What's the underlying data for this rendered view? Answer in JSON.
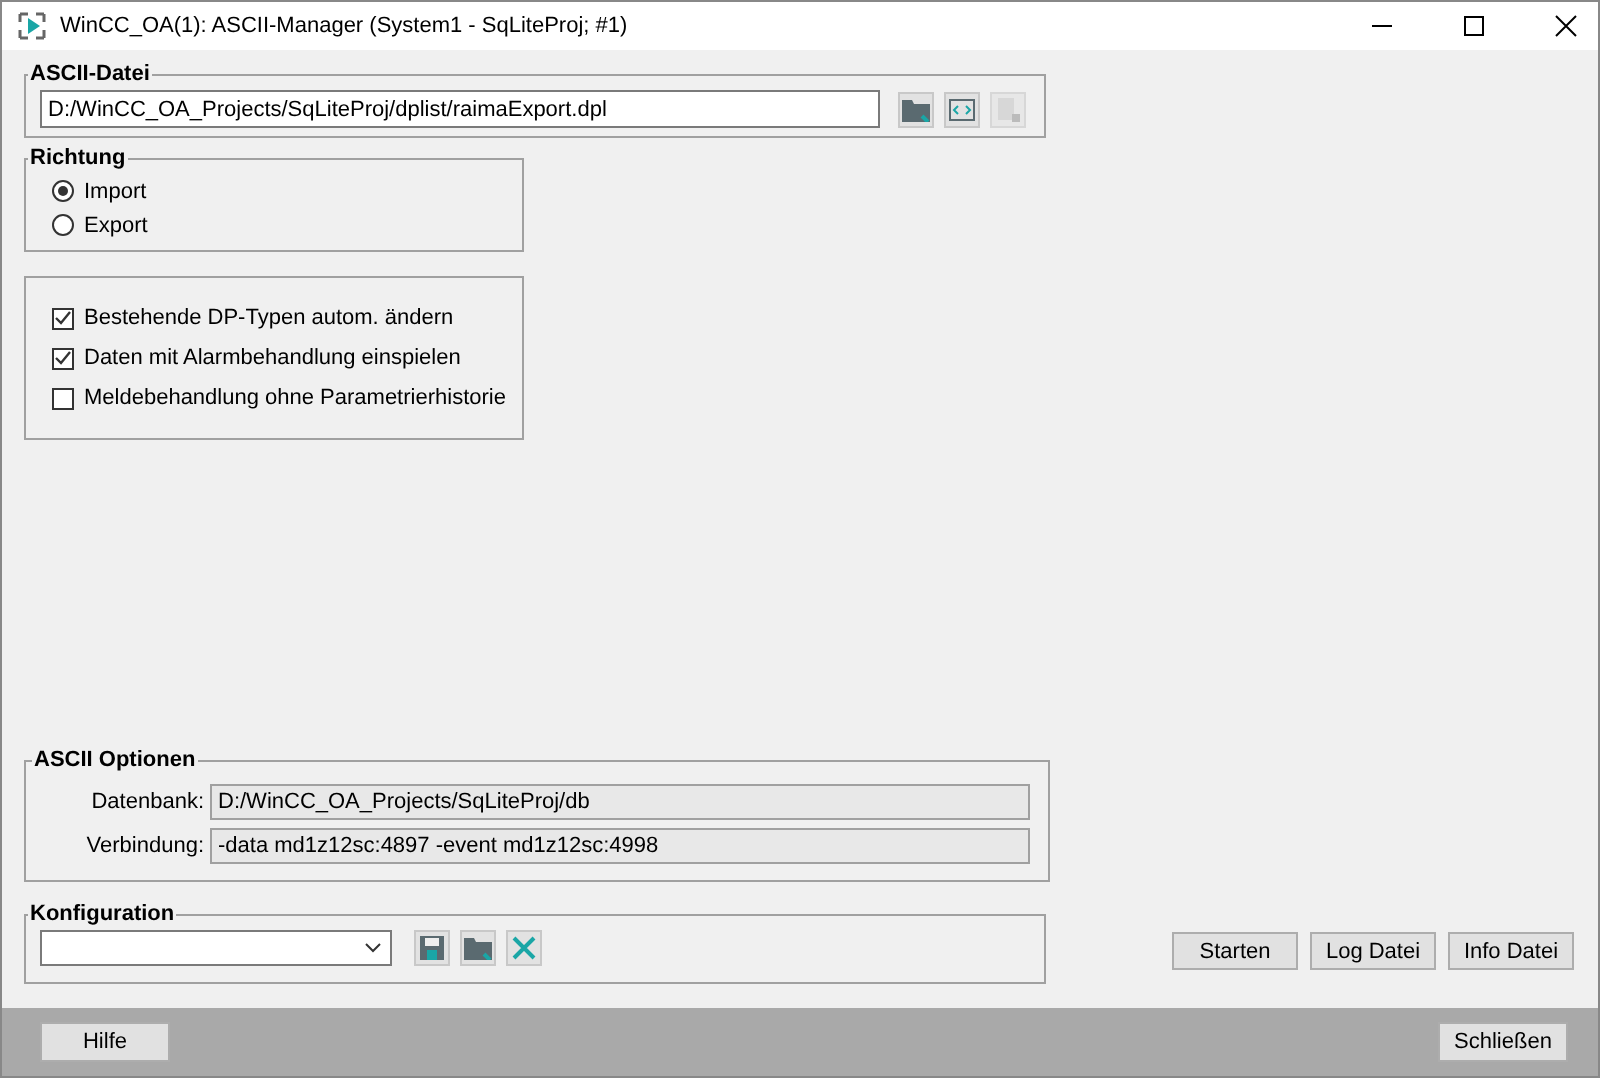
{
  "window": {
    "title": "WinCC_OA(1): ASCII-Manager (System1 - SqLiteProj; #1)"
  },
  "ascii_datei": {
    "legend": "ASCII-Datei",
    "path": "D:/WinCC_OA_Projects/SqLiteProj/dplist/raimaExport.dpl",
    "third_button_disabled": true
  },
  "richtung": {
    "legend": "Richtung",
    "options": [
      {
        "label": "Import",
        "selected": true
      },
      {
        "label": "Export",
        "selected": false
      }
    ]
  },
  "options": [
    {
      "label": "Bestehende DP-Typen autom. ändern",
      "checked": true
    },
    {
      "label": "Daten mit Alarmbehandlung einspielen",
      "checked": true
    },
    {
      "label": "Meldebehandlung ohne Parametrierhistorie",
      "checked": false
    }
  ],
  "ascii_optionen": {
    "legend": "ASCII Optionen",
    "fields": [
      {
        "label": "Datenbank:",
        "value": "D:/WinCC_OA_Projects/SqLiteProj/db"
      },
      {
        "label": "Verbindung:",
        "value": "-data md1z12sc:4897 -event md1z12sc:4998"
      }
    ]
  },
  "konfiguration": {
    "legend": "Konfiguration"
  },
  "action_buttons": [
    "Starten",
    "Log Datei",
    "Info Datei"
  ],
  "footer": {
    "help": "Hilfe",
    "close": "Schließen"
  }
}
